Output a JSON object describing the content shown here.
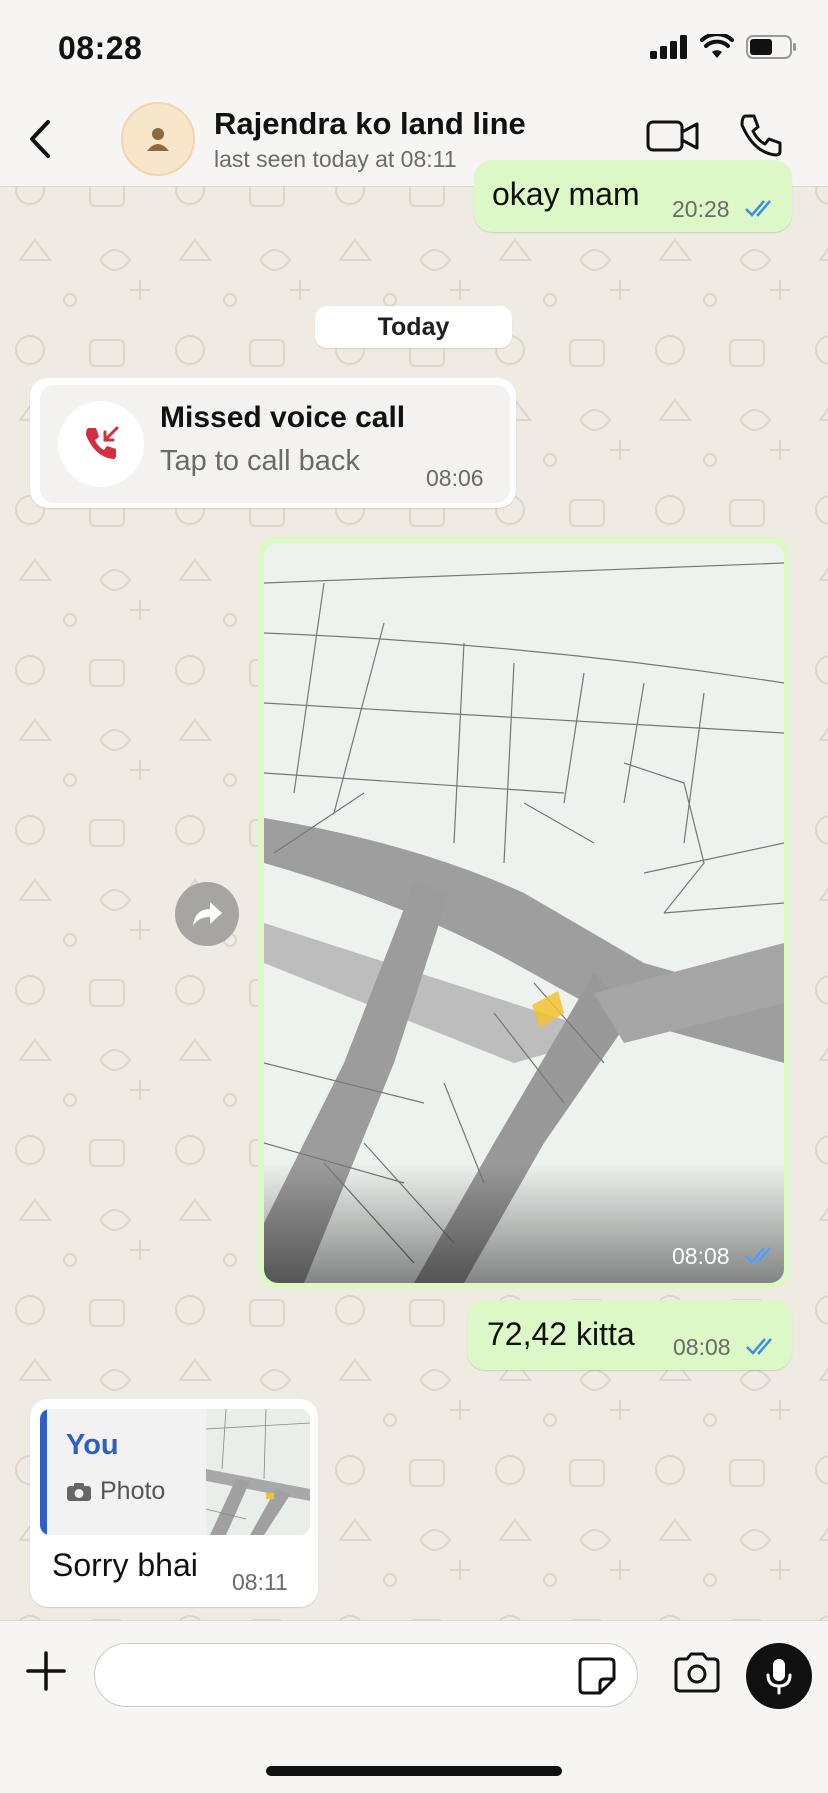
{
  "status_bar": {
    "time": "08:28",
    "icons": [
      "signal-icon",
      "wifi-icon",
      "battery-icon"
    ]
  },
  "header": {
    "contact_name": "Rajendra ko land line",
    "last_seen": "last seen today at 08:11",
    "icons": [
      "back-icon",
      "avatar-person-icon",
      "video-call-icon",
      "voice-call-icon"
    ]
  },
  "messages": {
    "prev_outgoing": {
      "text": "okay mam",
      "time": "20:28",
      "status": "read"
    },
    "date_separator": "Today",
    "missed_call": {
      "title": "Missed voice call",
      "subtitle": "Tap to call back",
      "time": "08:06"
    },
    "image_message": {
      "time": "08:08",
      "status": "read"
    },
    "text_message": {
      "text": "72,42 kitta",
      "time": "08:08",
      "status": "read"
    },
    "reply_message": {
      "quote_sender": "You",
      "quote_type": "Photo",
      "text": "Sorry bhai",
      "time": "08:11"
    }
  },
  "input_bar": {
    "placeholder": "",
    "icons": [
      "plus-icon",
      "sticker-icon",
      "camera-icon",
      "microphone-icon"
    ]
  },
  "colors": {
    "outgoing_bubble": "#dbf8c6",
    "incoming_bubble": "#ffffff",
    "read_ticks": "#3b8ee0",
    "quote_accent": "#2f5fc4",
    "missed_call_red": "#d42d3f",
    "chat_background": "#efeae2"
  }
}
